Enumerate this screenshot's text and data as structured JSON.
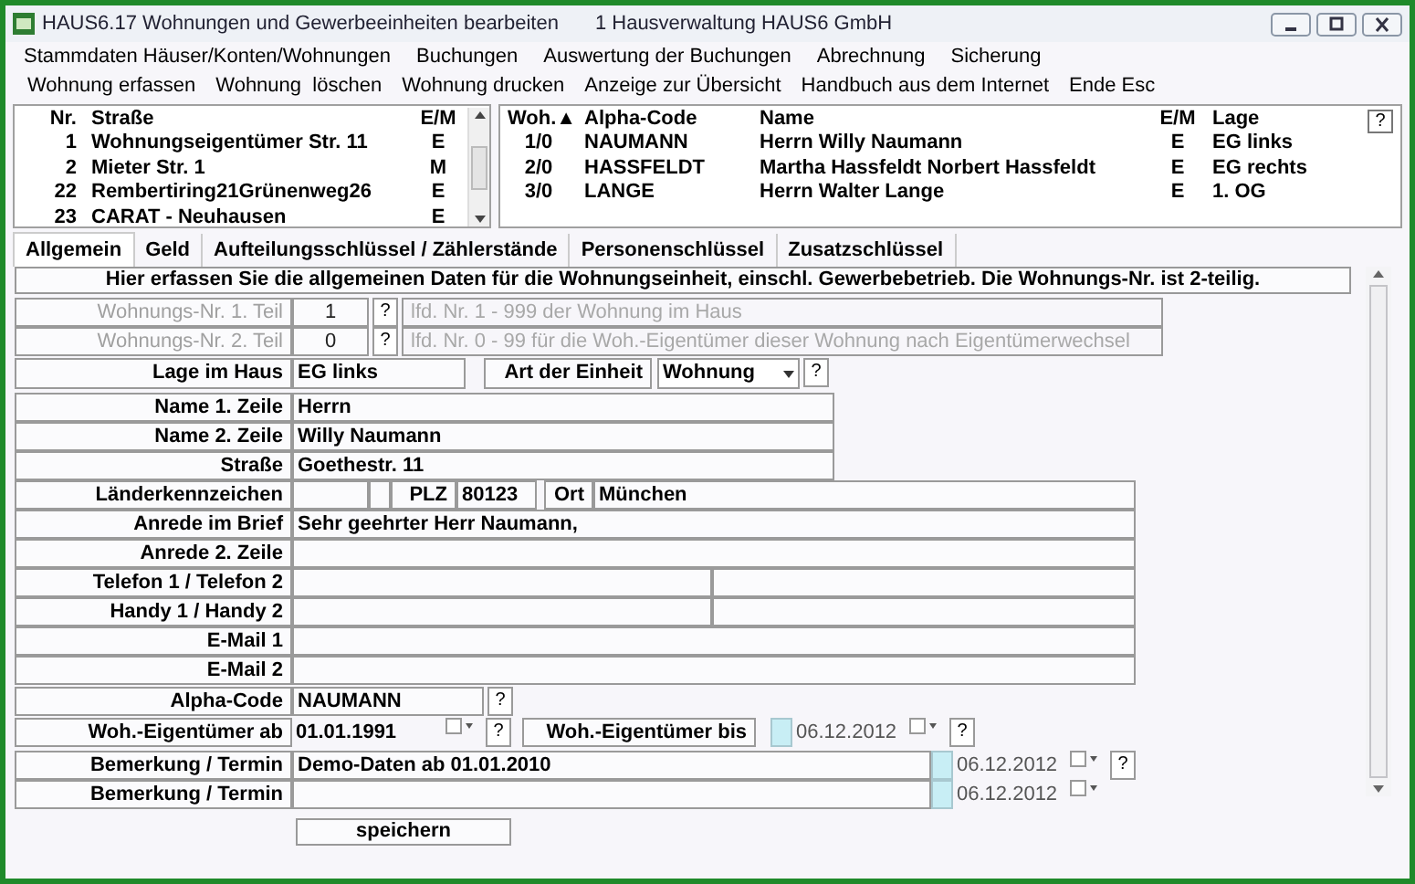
{
  "window": {
    "title": "HAUS6.17 Wohnungen und Gewerbeeinheiten bearbeiten",
    "subtitle": "1 Hausverwaltung HAUS6 GmbH"
  },
  "menu": [
    "Stammdaten Häuser/Konten/Wohnungen",
    "Buchungen",
    "Auswertung der Buchungen",
    "Abrechnung",
    "Sicherung"
  ],
  "toolbar": [
    "Wohnung erfassen",
    "Wohnung  löschen",
    "Wohnung drucken",
    "Anzeige zur Übersicht",
    "Handbuch aus dem Internet",
    "Ende Esc"
  ],
  "houses": {
    "columns": [
      "Nr.",
      "Straße",
      "E/M"
    ],
    "rows": [
      {
        "cells": [
          "1",
          "Wohnungseigentümer Str. 11",
          "E"
        ]
      },
      {
        "cells": [
          "2",
          "Mieter Str. 1",
          "M"
        ]
      },
      {
        "cells": [
          "22",
          "Rembertiring21Grünenweg26",
          "E"
        ]
      },
      {
        "cells": [
          "23",
          "CARAT - Neuhausen",
          "E"
        ]
      }
    ]
  },
  "units": {
    "columns": [
      "Woh.▲",
      "Alpha-Code",
      "Name",
      "E/M",
      "Lage"
    ],
    "help": "?",
    "rows": [
      {
        "cells": [
          "1/0",
          "NAUMANN",
          "Herrn Willy Naumann",
          "E",
          "EG links"
        ]
      },
      {
        "cells": [
          "2/0",
          "HASSFELDT",
          "Martha Hassfeldt Norbert Hassfeldt",
          "E",
          "EG rechts"
        ]
      },
      {
        "cells": [
          "3/0",
          "LANGE",
          "Herrn Walter Lange",
          "E",
          "1. OG"
        ]
      }
    ]
  },
  "tabs": [
    {
      "label": "Allgemein",
      "selected": true
    },
    {
      "label": "Geld",
      "selected": false
    },
    {
      "label": "Aufteilungsschlüssel / Zählerstände",
      "selected": false
    },
    {
      "label": "Personenschlüssel",
      "selected": false
    },
    {
      "label": "Zusatzschlüssel",
      "selected": false
    }
  ],
  "banner": "Hier erfassen Sie die allgemeinen Daten für die Wohnungseinheit, einschl. Gewerbebetrieb. Die Wohnungs-Nr. ist 2-teilig.",
  "form": {
    "nr_parts": [
      {
        "label": "Wohnungs-Nr. 1. Teil",
        "value": "1",
        "help": "?",
        "hint": "lfd. Nr. 1 - 999 der Wohnung im Haus",
        "disabled": true
      },
      {
        "label": "Wohnungs-Nr. 2. Teil",
        "value": "0",
        "help": "?",
        "hint": "lfd. Nr. 0 - 99 für die Woh.-Eigentümer dieser Wohnung nach Eigentümerwechsel",
        "disabled": true
      }
    ],
    "lage": {
      "label": "Lage im Haus",
      "value": "EG links"
    },
    "art": {
      "label": "Art der Einheit",
      "value": "Wohnung",
      "help": "?"
    },
    "names": [
      {
        "label": "Name 1. Zeile",
        "value": "Herrn"
      },
      {
        "label": "Name 2. Zeile",
        "value": "Willy Naumann"
      },
      {
        "label": "Straße",
        "value": "Goethestr. 11"
      }
    ],
    "land": {
      "label": "Länderkennzeichen"
    },
    "plz": {
      "label": "PLZ",
      "value": "80123"
    },
    "ort": {
      "label": "Ort",
      "value": "München"
    },
    "anrede": [
      {
        "label": "Anrede im Brief",
        "value": "Sehr geehrter Herr Naumann,"
      },
      {
        "label": "Anrede 2. Zeile"
      }
    ],
    "phones": [
      {
        "label": "Telefon 1 / Telefon 2"
      },
      {
        "label": "Handy 1 / Handy 2"
      }
    ],
    "emails": [
      {
        "label": "E-Mail 1"
      },
      {
        "label": "E-Mail 2"
      }
    ],
    "alpha": {
      "label": "Alpha-Code",
      "value": "NAUMANN",
      "help": "?"
    },
    "owner_from": {
      "label": "Woh.-Eigentümer ab",
      "value": "01.01.1991",
      "help": "?"
    },
    "owner_to": {
      "label": "Woh.-Eigentümer bis",
      "value": "06.12.2012",
      "help": "?",
      "checked": false
    },
    "remarks": [
      {
        "label": "Bemerkung / Termin",
        "value": "Demo-Daten ab 01.01.2010",
        "date": "06.12.2012",
        "help": "?",
        "checked": false
      },
      {
        "label": "Bemerkung / Termin",
        "date": "06.12.2012",
        "checked": false
      }
    ]
  },
  "save": "speichern"
}
